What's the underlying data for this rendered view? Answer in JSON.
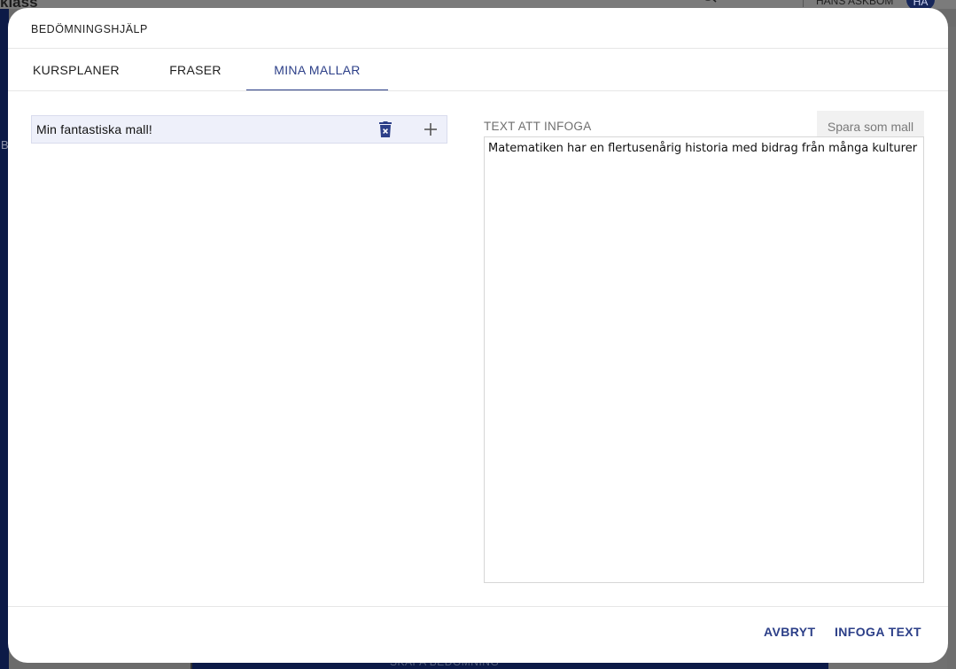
{
  "background": {
    "logo": "klass",
    "user_name": "HANS ASKBOM",
    "avatar_initials": "HA",
    "sidebar_letter": "B",
    "bottom_text": "SKAPA BEDÖMNING",
    "icons": [
      "search-icon",
      "apps-icon",
      "bell-icon"
    ]
  },
  "dialog": {
    "title": "BEDÖMNINGSHJÄLP",
    "tabs": [
      {
        "label": "KURSPLANER",
        "active": false
      },
      {
        "label": "FRASER",
        "active": false
      },
      {
        "label": "MINA MALLAR",
        "active": true
      }
    ],
    "templates": [
      {
        "name": "Min fantastiska mall!"
      }
    ],
    "template_icons": [
      "delete-icon",
      "add-icon"
    ],
    "insert_label": "TEXT ATT INFOGA",
    "save_as_template_label": "Spara som mall",
    "text_value": "Matematiken har en flertusenårig historia med bidrag från många kulturer",
    "cancel_label": "AVBRYT",
    "insert_text_label": "INFOGA TEXT"
  },
  "colors": {
    "accent": "#2c3f88",
    "selected_row": "#eef0fa",
    "navy": "#0c1a47"
  }
}
